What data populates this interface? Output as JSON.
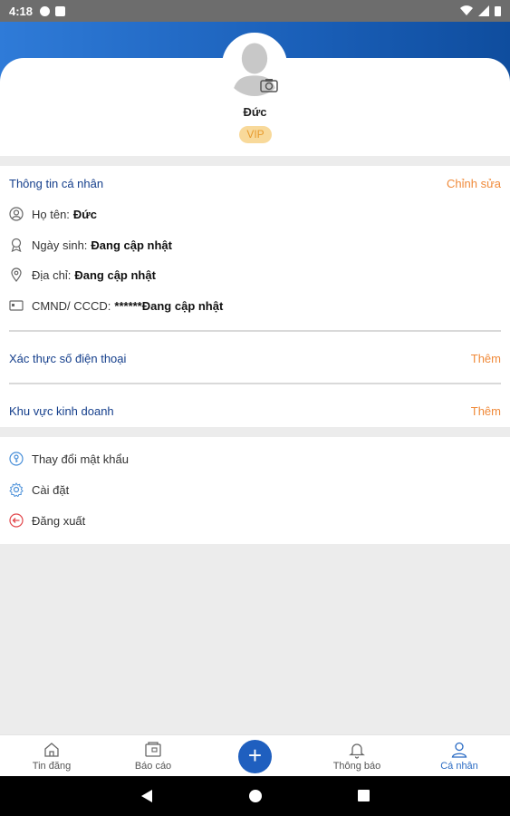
{
  "status_bar": {
    "time": "4:18"
  },
  "profile": {
    "name": "Đức",
    "badge": "VIP"
  },
  "personal_info": {
    "title": "Thông tin cá nhân",
    "edit_label": "Chỉnh sửa",
    "items": [
      {
        "label": "Họ tên:",
        "value": "Đức",
        "icon": "user-circle-icon"
      },
      {
        "label": "Ngày sinh:",
        "value": "Đang cập nhật",
        "icon": "birthday-icon"
      },
      {
        "label": "Địa chỉ:",
        "value": "Đang cập nhật",
        "icon": "location-icon"
      },
      {
        "label": "CMND/ CCCD:",
        "value": "******Đang cập nhật",
        "icon": "id-card-icon"
      }
    ]
  },
  "phone_verify": {
    "title": "Xác thực số điện thoại",
    "action": "Thêm"
  },
  "business_area": {
    "title": "Khu vực kinh doanh",
    "action": "Thêm"
  },
  "settings": {
    "items": [
      {
        "label": "Thay đổi mật khẩu",
        "icon": "key-icon"
      },
      {
        "label": "Cài đặt",
        "icon": "gear-icon"
      },
      {
        "label": "Đăng xuất",
        "icon": "logout-icon"
      }
    ]
  },
  "bottom_nav": {
    "items": [
      {
        "label": "Tin đăng",
        "icon": "home-icon"
      },
      {
        "label": "Báo cáo",
        "icon": "report-icon"
      },
      {
        "label": "Thông báo",
        "icon": "bell-icon"
      },
      {
        "label": "Cá nhân",
        "icon": "person-icon"
      }
    ],
    "fab_label": "+"
  },
  "colors": {
    "primary": "#1f5fbf",
    "accent": "#f08a3a",
    "heading": "#153f8c",
    "vip_bg": "#f8d99a"
  }
}
